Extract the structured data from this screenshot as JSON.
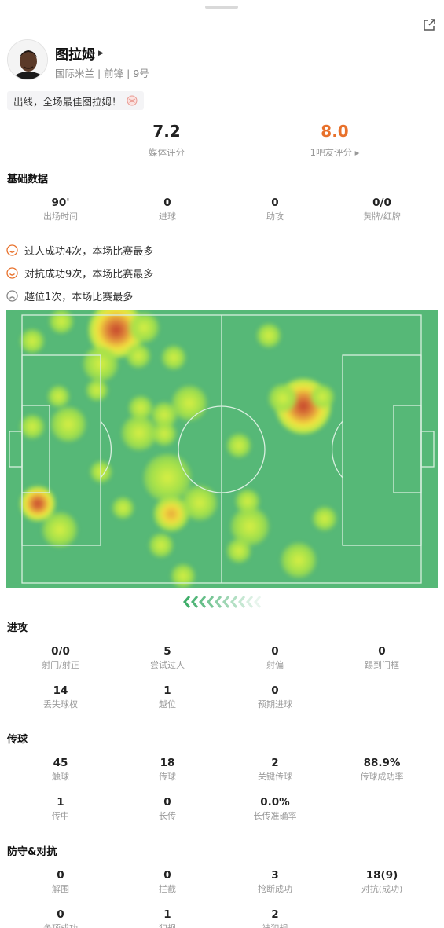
{
  "player": {
    "name": "图拉姆",
    "info": "国际米兰 | 前锋 | 9号",
    "comment": "出线，全场最佳图拉姆！"
  },
  "ratings": {
    "media": {
      "value": "7.2",
      "label": "媒体评分",
      "color": "#222222"
    },
    "fans": {
      "value": "8.0",
      "label": "1吧友评分 ▸",
      "color": "#e8712b"
    }
  },
  "basic": {
    "title": "基础数据",
    "stats": [
      {
        "value": "90'",
        "label": "出场时间"
      },
      {
        "value": "0",
        "label": "进球"
      },
      {
        "value": "0",
        "label": "助攻"
      },
      {
        "value": "0/0",
        "label": "黄牌/红牌"
      }
    ]
  },
  "highlights": [
    {
      "text": "过人成功4次，本场比赛最多",
      "icon": "smile-icon",
      "color": "#e8712b"
    },
    {
      "text": "对抗成功9次，本场比赛最多",
      "icon": "smile-icon",
      "color": "#e8712b"
    },
    {
      "text": "越位1次，本场比赛最多",
      "icon": "frown-icon",
      "color": "#888888"
    }
  ],
  "attack": {
    "title": "进攻",
    "stats": [
      {
        "value": "0/0",
        "label": "射门/射正"
      },
      {
        "value": "5",
        "label": "尝试过人"
      },
      {
        "value": "0",
        "label": "射偏"
      },
      {
        "value": "0",
        "label": "踢到门框"
      },
      {
        "value": "14",
        "label": "丢失球权"
      },
      {
        "value": "1",
        "label": "越位"
      },
      {
        "value": "0",
        "label": "预期进球"
      }
    ]
  },
  "passing": {
    "title": "传球",
    "stats": [
      {
        "value": "45",
        "label": "触球"
      },
      {
        "value": "18",
        "label": "传球"
      },
      {
        "value": "2",
        "label": "关键传球"
      },
      {
        "value": "88.9%",
        "label": "传球成功率"
      },
      {
        "value": "1",
        "label": "传中"
      },
      {
        "value": "0",
        "label": "长传"
      },
      {
        "value": "0.0%",
        "label": "长传准确率"
      }
    ]
  },
  "defense": {
    "title": "防守&对抗",
    "stats": [
      {
        "value": "0",
        "label": "解围"
      },
      {
        "value": "0",
        "label": "拦截"
      },
      {
        "value": "3",
        "label": "抢断成功"
      },
      {
        "value": "18(9)",
        "label": "对抗(成功)"
      },
      {
        "value": "0",
        "label": "争顶成功"
      },
      {
        "value": "1",
        "label": "犯规"
      },
      {
        "value": "2",
        "label": "被犯规"
      }
    ]
  },
  "colors": {
    "pitch": "#56b877",
    "accent": "#e8712b",
    "arrow": "#3fae6a"
  }
}
